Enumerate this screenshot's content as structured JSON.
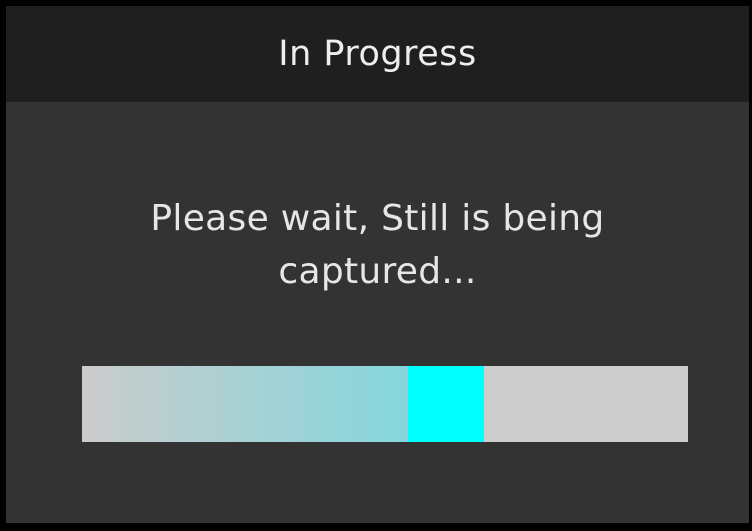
{
  "dialog": {
    "title": "In Progress",
    "message_line1": "Please wait, Still is being",
    "message_line2": "captured..."
  },
  "progress": {
    "indeterminate": true,
    "head_start_fraction": 0.538,
    "head_end_fraction": 0.664,
    "colors": {
      "track": "#cccccc",
      "head": "#00ffff",
      "trail_start": "#cccccc",
      "trail_end": "#84d6dc"
    }
  },
  "colors": {
    "window_background": "#000000",
    "dialog_background": "#333333",
    "titlebar_background": "#1f1f1f",
    "text": "#e6e6e6"
  }
}
